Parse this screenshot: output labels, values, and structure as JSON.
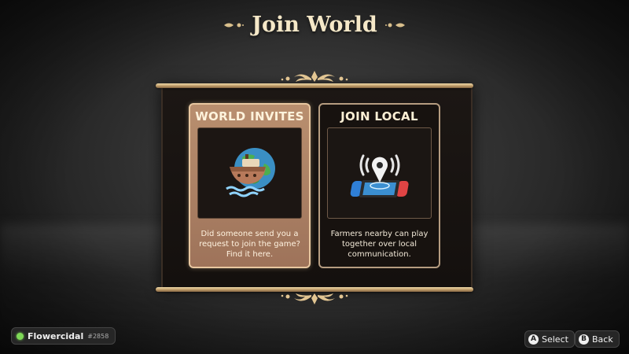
{
  "header": {
    "title": "Join World"
  },
  "cards": [
    {
      "title": "WORLD INVITES",
      "icon": "ship-globe-icon",
      "description": "Did someone send you a request to join the game? Find it here.",
      "selected": true
    },
    {
      "title": "JOIN LOCAL",
      "icon": "local-console-signal-icon",
      "description": "Farmers nearby can play together over local communication.",
      "selected": false
    }
  ],
  "player": {
    "name": "Flowercidal",
    "tag": "#2858",
    "status_color": "#7ed957"
  },
  "controls": [
    {
      "glyph": "A",
      "label": "Select"
    },
    {
      "glyph": "B",
      "label": "Back"
    }
  ],
  "colors": {
    "accent_gold": "#c9a46b",
    "title_text": "#f5e8c8",
    "selected_card": "#b98f6f"
  }
}
